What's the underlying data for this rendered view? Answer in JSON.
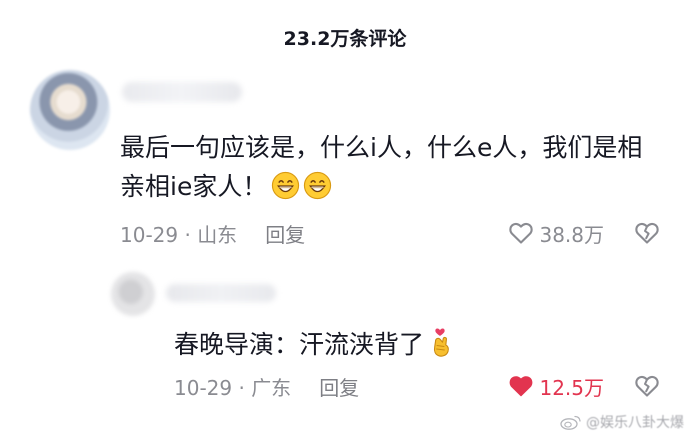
{
  "header": {
    "title": "23.2万条评论"
  },
  "comments": [
    {
      "text": "最后一句应该是，什么i人，什么e人，我们是相亲相ie家人！",
      "emojis": [
        "grinning-face",
        "grinning-face"
      ],
      "date_location": "10-29 · 山东",
      "reply_label": "回复",
      "likes": "38.8万",
      "liked": false
    },
    {
      "text": "春晚导演：汗流浃背了",
      "emoji": "finger-heart-hand",
      "date_location": "10-29 · 广东",
      "reply_label": "回复",
      "likes": "12.5万",
      "liked": true
    }
  ],
  "watermark": {
    "text": "@娱乐八卦大爆"
  },
  "colors": {
    "text": "#161823",
    "meta": "#8a8b91",
    "liked": "#e2344f",
    "background": "#ffffff"
  }
}
